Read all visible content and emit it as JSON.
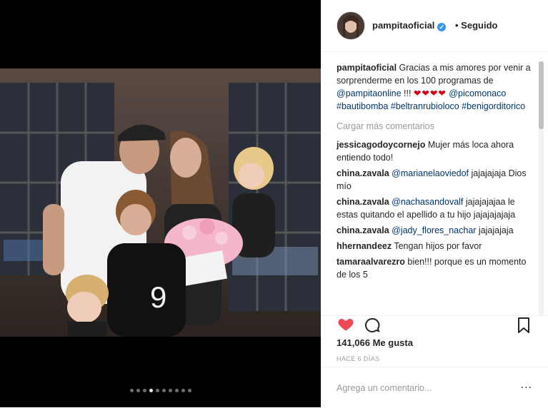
{
  "post": {
    "username": "pampitaoficial",
    "follow_status": "Seguido",
    "caption_text": "Gracias a mis amores por venir a sorprenderme en los 100 programas de",
    "caption_mention": "@pampitaonline",
    "caption_after": " !!! ",
    "caption_hearts": "❤❤❤❤",
    "caption_tags": [
      "@picomonaco",
      "#bautibomba",
      "#beltranrubioloco",
      "#benigorditorico"
    ],
    "load_more": "Cargar más comentarios",
    "likes": "141,066 Me gusta",
    "time_ago": "HACE 6 DÍAS",
    "add_comment_placeholder": "Agrega un comentario...",
    "options": "..."
  },
  "comments": [
    {
      "user": "jessicagodoycornejo",
      "mention": "",
      "text": "Mujer más loca ahora entiendo todo!"
    },
    {
      "user": "china.zavala",
      "mention": "@marianelaoviedof",
      "text": " jajajajaja Dios mío"
    },
    {
      "user": "china.zavala",
      "mention": "@nachasandovalf",
      "text": " jajajajajaa le estas quitando el apellido a tu hijo jajajajajaja"
    },
    {
      "user": "china.zavala",
      "mention": "@jady_flores_nachar",
      "text": " jajajajaja"
    },
    {
      "user": "hhernandeez",
      "mention": "",
      "text": "Tengan hijos por favor"
    },
    {
      "user": "tamaraalvarezro",
      "mention": "",
      "text": "bien!!! porque es un momento de los 5"
    }
  ],
  "carousel": {
    "count": 10,
    "active_index": 3
  },
  "colors": {
    "like": "#ed4956",
    "link": "#003569",
    "verified": "#3897f0"
  }
}
